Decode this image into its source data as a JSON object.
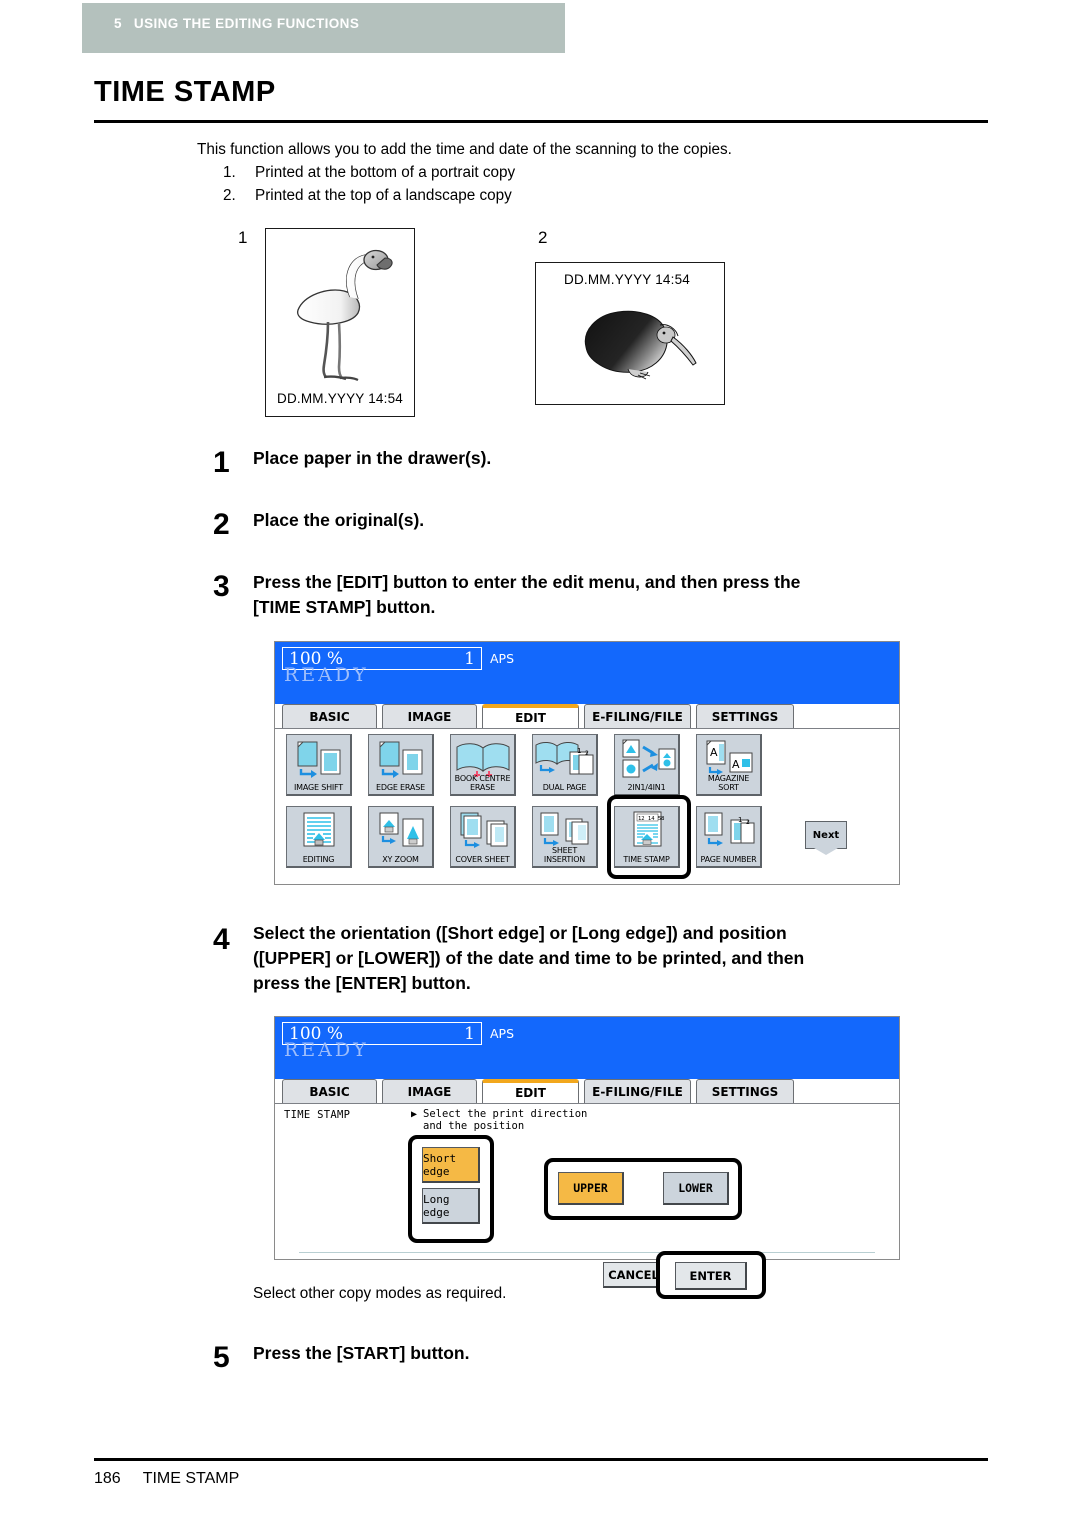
{
  "chapter": {
    "number": "5",
    "title": "USING THE EDITING FUNCTIONS"
  },
  "page_title": "TIME STAMP",
  "intro": {
    "paragraph": "This function allows you to add the time and date of the scanning to the copies.",
    "items": [
      {
        "marker": "1.",
        "text": "Printed at the bottom of a portrait copy"
      },
      {
        "marker": "2.",
        "text": "Printed at the top of a landscape copy"
      }
    ]
  },
  "figures": [
    {
      "label": "1",
      "stamp": "DD.MM.YYYY  14:54",
      "subject": "flamingo"
    },
    {
      "label": "2",
      "stamp": "DD.MM.YYYY  14:54",
      "subject": "kiwi"
    }
  ],
  "steps": [
    {
      "num": "1",
      "text": "Place paper in the drawer(s)."
    },
    {
      "num": "2",
      "text": "Place the original(s)."
    },
    {
      "num": "3",
      "text": "Press the [EDIT] button to enter the edit menu, and then press the\n[TIME STAMP] button."
    },
    {
      "num": "4",
      "text": "Select the orientation ([Short edge] or [Long edge]) and position\n([UPPER] or [LOWER]) of the date and time to be printed, and then\npress the [ENTER] button."
    },
    {
      "num": "5",
      "text": "Press the [START] button."
    }
  ],
  "note": "Select other copy modes as required.",
  "panel_common": {
    "zoom_percent": "100 %",
    "copy_count": "1",
    "paper_mode": "APS",
    "status": "READY",
    "tabs": [
      {
        "label": "BASIC",
        "active": false
      },
      {
        "label": "IMAGE",
        "active": false
      },
      {
        "label": "EDIT",
        "active": true
      },
      {
        "label": "E-FILING/FILE",
        "active": false
      },
      {
        "label": "SETTINGS",
        "active": false
      }
    ],
    "accent_color": "#f2a71c",
    "blue_color": "#1368fc",
    "button_color": "#ccd4dc",
    "selected_color": "#f5b945"
  },
  "panel_edit_menu": {
    "buttons_row1": [
      {
        "label": "IMAGE SHIFT",
        "icon": "image-shift-icon"
      },
      {
        "label": "EDGE ERASE",
        "icon": "edge-erase-icon"
      },
      {
        "label": "BOOK CENTRE\nERASE",
        "icon": "book-centre-erase-icon"
      },
      {
        "label": "DUAL  PAGE",
        "icon": "dual-page-icon"
      },
      {
        "label": "2IN1/4IN1",
        "icon": "2in1-4in1-icon"
      },
      {
        "label": "MAGAZINE SORT",
        "icon": "magazine-sort-icon"
      }
    ],
    "buttons_row2": [
      {
        "label": "EDITING",
        "icon": "editing-icon"
      },
      {
        "label": "XY ZOOM",
        "icon": "xy-zoom-icon"
      },
      {
        "label": "COVER SHEET",
        "icon": "cover-sheet-icon"
      },
      {
        "label": "SHEET\nINSERTION",
        "icon": "sheet-insertion-icon"
      },
      {
        "label": "TIME STAMP",
        "icon": "time-stamp-icon",
        "highlighted": true
      },
      {
        "label": "PAGE NUMBER",
        "icon": "page-number-icon"
      }
    ],
    "next_label": "Next"
  },
  "panel_time_stamp": {
    "function_name": "TIME STAMP",
    "prompt": "Select the print direction\nand the position",
    "direction_options": [
      {
        "label": "Short edge",
        "selected": true
      },
      {
        "label": "Long edge",
        "selected": false
      }
    ],
    "position_options": [
      {
        "label": "UPPER",
        "selected": true
      },
      {
        "label": "LOWER",
        "selected": false
      }
    ],
    "cancel_label": "CANCEL",
    "enter_label": "ENTER"
  },
  "footer": {
    "page_number": "186",
    "section": "TIME STAMP"
  }
}
